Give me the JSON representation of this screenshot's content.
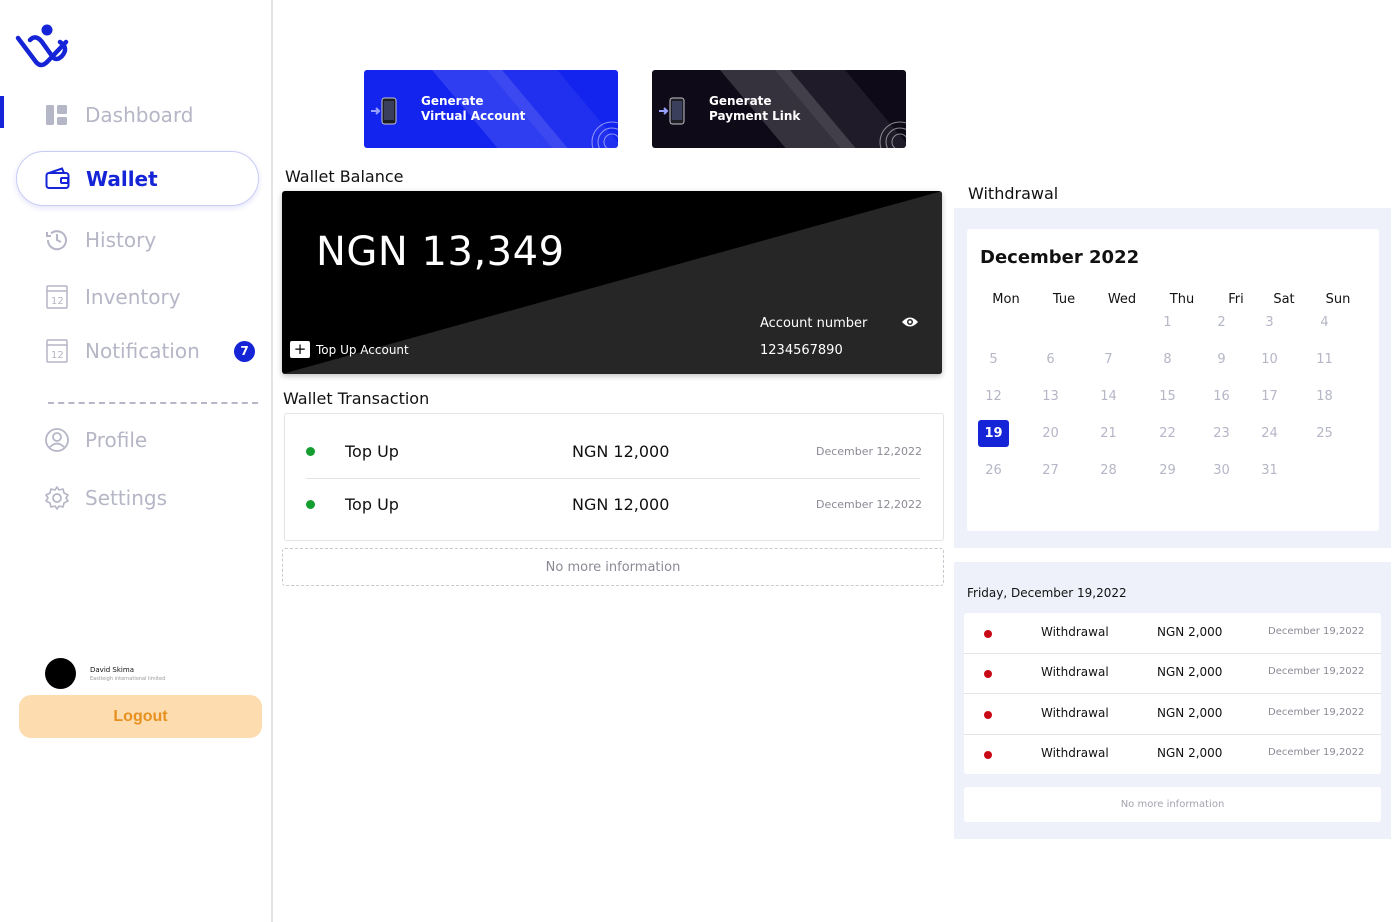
{
  "sidebar": {
    "items": [
      {
        "label": "Dashboard",
        "icon": "dashboard-icon"
      },
      {
        "label": "Wallet",
        "icon": "wallet-icon"
      },
      {
        "label": "History",
        "icon": "history-icon"
      },
      {
        "label": "Inventory",
        "icon": "inventory-icon"
      },
      {
        "label": "Notification",
        "icon": "notification-icon",
        "badge": "7"
      },
      {
        "label": "Profile",
        "icon": "profile-icon"
      },
      {
        "label": "Settings",
        "icon": "settings-icon"
      }
    ],
    "active": "Wallet",
    "user": {
      "name": "David Skima",
      "org": "Eastleigh international limited"
    },
    "logout_label": "Logout"
  },
  "actions": [
    {
      "label": "Generate Virtual Account",
      "color": "#1424ef",
      "icon": "phone-transfer-icon"
    },
    {
      "label": "Generate Payment Link",
      "color": "#0f0a18",
      "icon": "phone-transfer-icon"
    }
  ],
  "wallet": {
    "title": "Wallet Balance",
    "amount": "NGN 13,349",
    "topup_label": "Top Up Account",
    "account_label": "Account number",
    "account_number": "1234567890"
  },
  "transactions": {
    "title": "Wallet Transaction",
    "rows": [
      {
        "type": "Top Up",
        "amount": "NGN 12,000",
        "date": "December 12,2022"
      },
      {
        "type": "Top Up",
        "amount": "NGN 12,000",
        "date": "December 12,2022"
      }
    ],
    "no_more": "No more information"
  },
  "withdrawal": {
    "title": "Withdrawal",
    "calendar": {
      "month": "December 2022",
      "weekdays": [
        "Mon",
        "Tue",
        "Wed",
        "Thu",
        "Fri",
        "Sat",
        "Sun"
      ],
      "selected_day": "19"
    },
    "selected_date_label": "Friday, December 19,2022",
    "rows": [
      {
        "type": "Withdrawal",
        "amount": "NGN 2,000",
        "date": "December 19,2022"
      },
      {
        "type": "Withdrawal",
        "amount": "NGN 2,000",
        "date": "December 19,2022"
      },
      {
        "type": "Withdrawal",
        "amount": "NGN 2,000",
        "date": "December 19,2022"
      },
      {
        "type": "Withdrawal",
        "amount": "NGN 2,000",
        "date": "December 19,2022"
      }
    ],
    "no_more": "No more information"
  },
  "colors": {
    "accent": "#1424d6",
    "success": "#139e2f",
    "danger": "#c80a16",
    "logout_bg": "#fddcb0",
    "logout_text": "#e8901f"
  }
}
